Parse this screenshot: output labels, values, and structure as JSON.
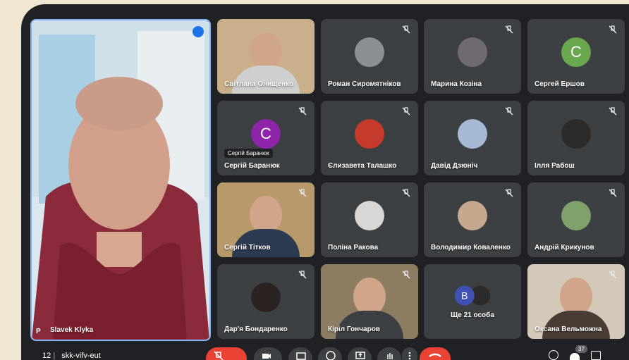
{
  "meeting": {
    "code": "skk-vifv-eut",
    "time_partial": "12",
    "participant_count": "37"
  },
  "main": {
    "name": "Slavek Klyka",
    "pin_label": "P"
  },
  "tiles": [
    {
      "name": "Світлана Онищенко"
    },
    {
      "name": "Роман Сиромятніков"
    },
    {
      "name": "Марина Козіна"
    },
    {
      "name": "Сергей Ершов",
      "letter": "C"
    },
    {
      "name": "Сергій Баранюк",
      "letter": "C",
      "chip": "Сергій Баранюк"
    },
    {
      "name": "Єлизавета Талашко"
    },
    {
      "name": "Давід Дзюніч"
    },
    {
      "name": "Ілля Рабош"
    },
    {
      "name": "Сергій Тітков"
    },
    {
      "name": "Поліна Ракова"
    },
    {
      "name": "Володимир Коваленко"
    },
    {
      "name": "Андрій Крикунов"
    },
    {
      "name": "Дар'я Бондаренко"
    },
    {
      "name": "Кіріл Гончаров"
    },
    {
      "name": "Ще 21 особа",
      "letter": "B"
    },
    {
      "name": "Оксана Вельможна"
    }
  ],
  "colors": {
    "accent": "#8ab4f8",
    "end_call": "#ea4335",
    "avatar_green": "#6aa84f",
    "avatar_purple": "#8e24aa",
    "avatar_indigo": "#3f51b5"
  }
}
